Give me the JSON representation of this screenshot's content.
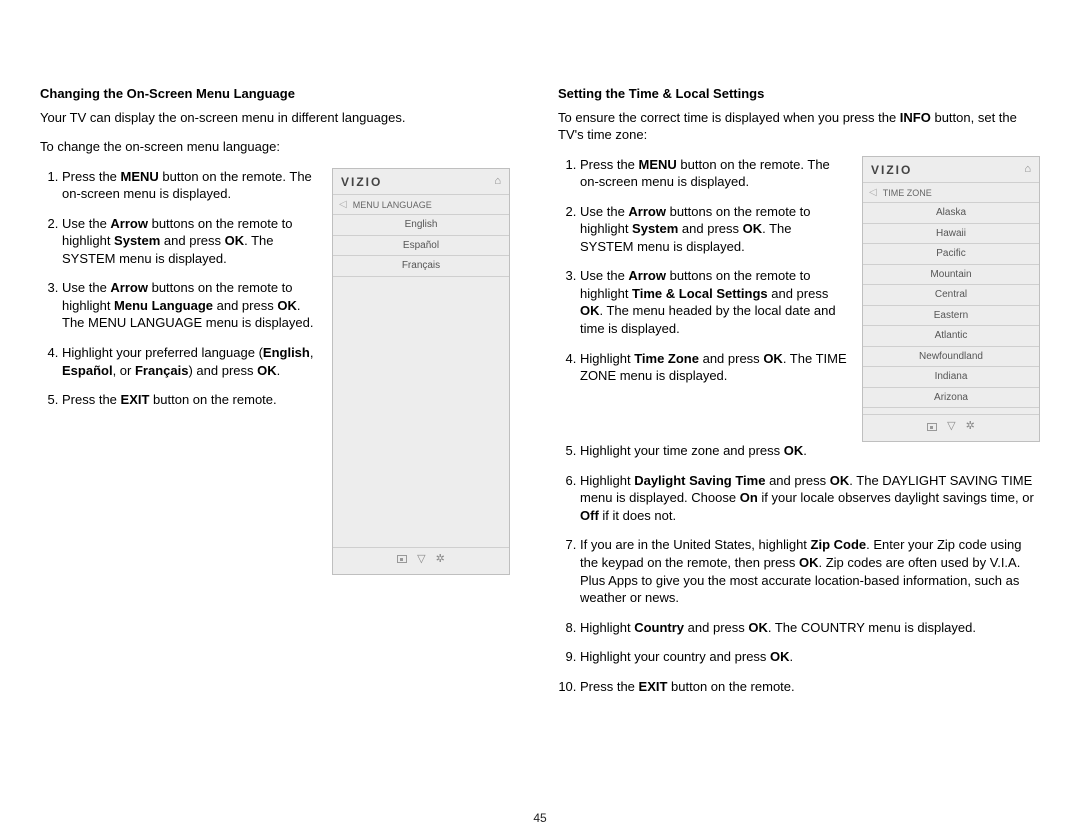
{
  "page_number": "45",
  "left": {
    "heading": "Changing the On-Screen Menu Language",
    "intro1": "Your TV can display the on-screen menu in different languages.",
    "intro2": "To change the on-screen menu language:",
    "steps_html": [
      "Press the <b>MENU</b> button on the remote. The on-screen menu is displayed.",
      "Use the <b>Arrow</b> buttons on the remote to highlight <b>System</b> and press <b>OK</b>. The SYSTEM menu is displayed.",
      "Use the <b>Arrow</b> buttons on the remote to highlight <b>Menu Language</b> and press <b>OK</b>. The MENU LANGUAGE menu is displayed.",
      "Highlight your preferred language (<b>English</b>, <b>Español</b>, or <b>Français</b>) and press <b>OK</b>.",
      "Press the <b>EXIT</b> button on the remote."
    ],
    "osd": {
      "brand": "VIZIO",
      "title": "MENU LANGUAGE",
      "items": [
        "English",
        "Español",
        "Français"
      ]
    }
  },
  "right": {
    "heading": "Setting the Time & Local Settings",
    "intro_html": "To ensure the correct time is displayed when you press the <b>INFO</b> button, set the TV's time zone:",
    "steps_html": [
      "Press the <b>MENU</b> button on the remote. The on-screen menu is displayed.",
      "Use the <b>Arrow</b> buttons on the remote to highlight <b>System</b> and press <b>OK</b>. The SYSTEM menu is displayed.",
      "Use the <b>Arrow</b> buttons on the remote to highlight <b>Time &amp; Local Settings</b> and press <b>OK</b>. The menu headed by the local date and time is displayed.",
      "Highlight <b>Time Zone</b> and press <b>OK</b>. The TIME ZONE menu is displayed.",
      "Highlight your time zone and press <b>OK</b>.",
      "Highlight <b>Daylight Saving Time</b> and press <b>OK</b>. The DAYLIGHT SAVING TIME menu is displayed. Choose <b>On</b> if your locale observes daylight savings time, or <b>Off</b> if it does not.",
      "If you are in the United States, highlight <b>Zip Code</b>. Enter your Zip code using the keypad on the remote, then press <b>OK</b>. Zip codes are often used by V.I.A. Plus Apps to give you the most accurate location-based information, such as weather or news.",
      "Highlight <b>Country</b> and press <b>OK</b>. The COUNTRY menu is displayed.",
      "Highlight your country and press <b>OK</b>.",
      "Press the <b>EXIT</b> button on the remote."
    ],
    "osd": {
      "brand": "VIZIO",
      "title": "TIME ZONE",
      "items": [
        "Alaska",
        "Hawaii",
        "Pacific",
        "Mountain",
        "Central",
        "Eastern",
        "Atlantic",
        "Newfoundland",
        "Indiana",
        "Arizona"
      ]
    }
  }
}
